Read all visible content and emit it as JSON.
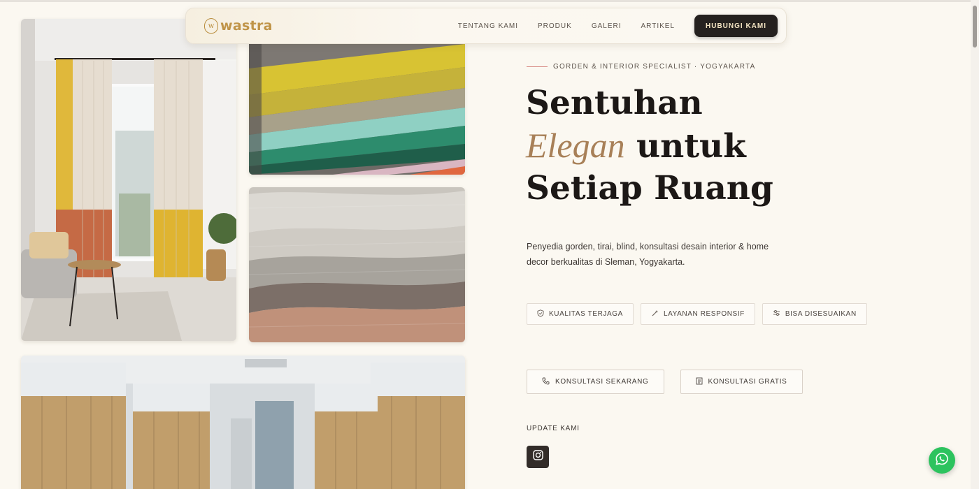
{
  "brand": {
    "mark": "w",
    "name": "wastra"
  },
  "nav": {
    "links": [
      "TENTANG KAMI",
      "PRODUK",
      "GALERI",
      "ARTIKEL"
    ],
    "cta": "HUBUNGI KAMI"
  },
  "hero": {
    "eyebrow": "GORDEN & INTERIOR SPECIALIST · YOGYAKARTA",
    "headline_line1": "Sentuhan",
    "headline_accent": "Elegan",
    "headline_line2_rest": " untuk",
    "headline_line3": "Setiap Ruang",
    "description": "Penyedia gorden, tirai, blind, konsultasi desain interior & home decor berkualitas di Sleman, Yogyakarta."
  },
  "features": [
    {
      "icon": "shield-icon",
      "label": "KUALITAS TERJAGA"
    },
    {
      "icon": "sparkle-icon",
      "label": "LAYANAN RESPONSIF"
    },
    {
      "icon": "sliders-icon",
      "label": "BISA DISESUAIKAN"
    }
  ],
  "ctas": [
    {
      "icon": "phone-icon",
      "label": "KONSULTASI SEKARANG"
    },
    {
      "icon": "document-icon",
      "label": "KONSULTASI GRATIS"
    }
  ],
  "social": {
    "label": "UPDATE KAMI",
    "icon": "instagram-icon"
  },
  "floating": {
    "icon": "whatsapp-icon"
  },
  "colors": {
    "background": "#fbf8f1",
    "accent_gold": "#c09448",
    "dark": "#25211f",
    "accent_italic": "#a88058",
    "whatsapp": "#2cc35e"
  }
}
